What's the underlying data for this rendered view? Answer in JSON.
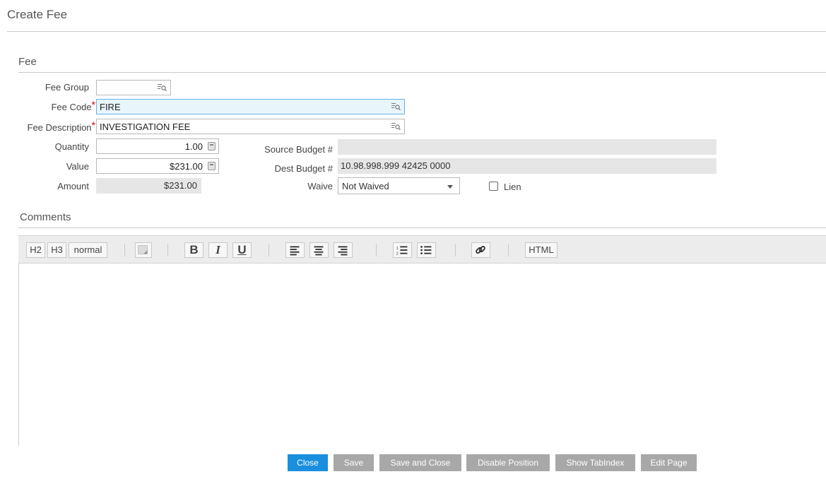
{
  "page": {
    "title": "Create Fee"
  },
  "sections": {
    "fee": "Fee",
    "comments": "Comments"
  },
  "fields": {
    "fee_group": {
      "label": "Fee Group",
      "value": ""
    },
    "fee_code": {
      "label": "Fee Code",
      "value": "FIRE",
      "required": "*"
    },
    "fee_description": {
      "label": "Fee Description",
      "value": "INVESTIGATION FEE",
      "required": "*"
    },
    "quantity": {
      "label": "Quantity",
      "value": "1.00"
    },
    "value": {
      "label": "Value",
      "value": "$231.00"
    },
    "amount": {
      "label": "Amount",
      "value": "$231.00"
    },
    "source_budget": {
      "label": "Source Budget #",
      "value": ""
    },
    "dest_budget": {
      "label": "Dest Budget #",
      "value": "10.98.998.999 42425 0000"
    },
    "waive": {
      "label": "Waive",
      "value": "Not Waived"
    },
    "lien": {
      "label": "Lien",
      "checked": false
    }
  },
  "toolbar": {
    "h2": "H2",
    "h3": "H3",
    "normal": "normal",
    "bold": "B",
    "italic": "I",
    "underline": "U",
    "html": "HTML"
  },
  "buttons": {
    "close": "Close",
    "save": "Save",
    "save_and_close": "Save and Close",
    "disable_position": "Disable Position",
    "show_tabindex": "Show TabIndex",
    "edit_page": "Edit Page"
  },
  "colors": {
    "primary_button": "#1a8fdd",
    "secondary_button": "#a8a8a8",
    "required_star": "#cc0000",
    "focus_border": "#66afe9"
  }
}
